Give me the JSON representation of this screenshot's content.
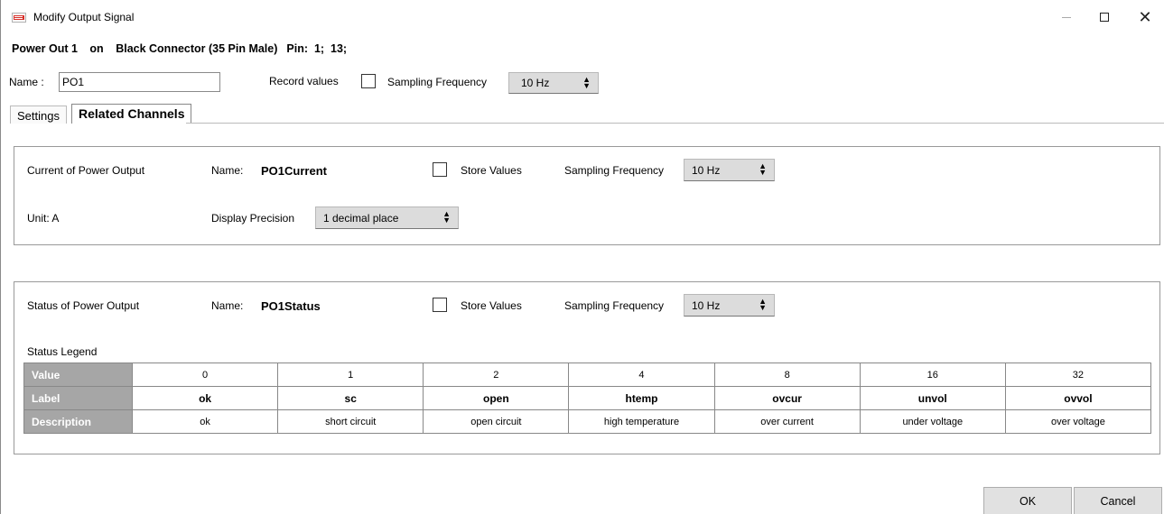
{
  "window": {
    "title": "Modify Output Signal",
    "controls": {
      "minimize": "—",
      "maximize": "□",
      "close": "✕"
    }
  },
  "header": {
    "signal": "Power Out 1",
    "on": "on",
    "connector": "Black Connector (35 Pin Male)",
    "pin": "Pin:  1;  13;"
  },
  "name_row": {
    "name_label": "Name :",
    "name_value": "PO1",
    "record_label": "Record values",
    "sampling_label": "Sampling Frequency",
    "sampling_value": "10 Hz"
  },
  "tabs": [
    {
      "label": "Settings",
      "active": false
    },
    {
      "label": "Related Channels",
      "active": true
    }
  ],
  "current_panel": {
    "title": "Current of Power Output",
    "name_label": "Name:",
    "name_value": "PO1Current",
    "store_label": "Store Values",
    "sampling_label": "Sampling Frequency",
    "sampling_value": "10 Hz",
    "unit_label": "Unit:",
    "unit_value": "A",
    "precision_label": "Display Precision",
    "precision_value": "1 decimal place"
  },
  "status_panel": {
    "title": "Status of Power Output",
    "name_label": "Name:",
    "name_value": "PO1Status",
    "store_label": "Store Values",
    "sampling_label": "Sampling Frequency",
    "sampling_value": "10 Hz",
    "legend_title": "Status Legend",
    "legend": {
      "row_headers": [
        "Value",
        "Label",
        "Description"
      ],
      "values": [
        "0",
        "1",
        "2",
        "4",
        "8",
        "16",
        "32"
      ],
      "labels": [
        "ok",
        "sc",
        "open",
        "htemp",
        "ovcur",
        "unvol",
        "ovvol"
      ],
      "descriptions": [
        "ok",
        "short circuit",
        "open circuit",
        "high temperature",
        "over current",
        "under voltage",
        "over voltage"
      ]
    }
  },
  "buttons": {
    "ok": "OK",
    "cancel": "Cancel"
  },
  "colors": {
    "table_header_bg": "#a6a6a6",
    "select_bg": "#dcdcdc",
    "button_bg": "#e1e1e1"
  }
}
